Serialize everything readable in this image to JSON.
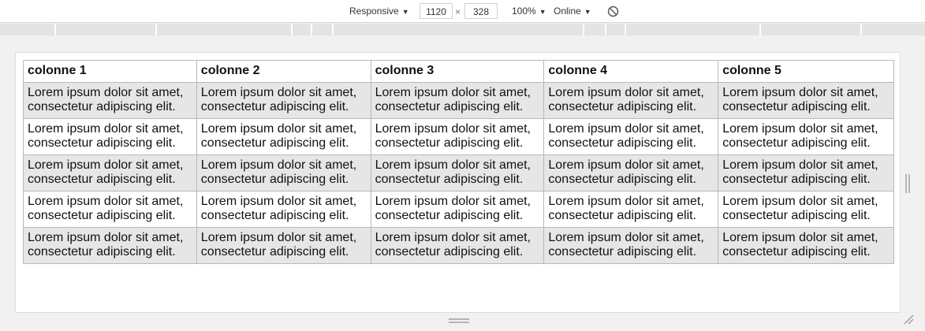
{
  "toolbar": {
    "device_label": "Responsive",
    "width_value": "1120",
    "times_symbol": "×",
    "height_value": "328",
    "zoom_label": "100%",
    "network_label": "Online",
    "caret": "▼"
  },
  "table": {
    "headers": [
      "colonne 1",
      "colonne 2",
      "colonne 3",
      "colonne 4",
      "colonne 5"
    ],
    "rows": [
      [
        "Lorem ipsum dolor sit amet, consectetur adipiscing elit.",
        "Lorem ipsum dolor sit amet, consectetur adipiscing elit.",
        "Lorem ipsum dolor sit amet, consectetur adipiscing elit.",
        "Lorem ipsum dolor sit amet, consectetur adipiscing elit.",
        "Lorem ipsum dolor sit amet, consectetur adipiscing elit."
      ],
      [
        "Lorem ipsum dolor sit amet, consectetur adipiscing elit.",
        "Lorem ipsum dolor sit amet, consectetur adipiscing elit.",
        "Lorem ipsum dolor sit amet, consectetur adipiscing elit.",
        "Lorem ipsum dolor sit amet, consectetur adipiscing elit.",
        "Lorem ipsum dolor sit amet, consectetur adipiscing elit."
      ],
      [
        "Lorem ipsum dolor sit amet, consectetur adipiscing elit.",
        "Lorem ipsum dolor sit amet, consectetur adipiscing elit.",
        "Lorem ipsum dolor sit amet, consectetur adipiscing elit.",
        "Lorem ipsum dolor sit amet, consectetur adipiscing elit.",
        "Lorem ipsum dolor sit amet, consectetur adipiscing elit."
      ],
      [
        "Lorem ipsum dolor sit amet, consectetur adipiscing elit.",
        "Lorem ipsum dolor sit amet, consectetur adipiscing elit.",
        "Lorem ipsum dolor sit amet, consectetur adipiscing elit.",
        "Lorem ipsum dolor sit amet, consectetur adipiscing elit.",
        "Lorem ipsum dolor sit amet, consectetur adipiscing elit."
      ],
      [
        "Lorem ipsum dolor sit amet, consectetur adipiscing elit.",
        "Lorem ipsum dolor sit amet, consectetur adipiscing elit.",
        "Lorem ipsum dolor sit amet, consectetur adipiscing elit.",
        "Lorem ipsum dolor sit amet, consectetur adipiscing elit.",
        "Lorem ipsum dolor sit amet, consectetur adipiscing elit."
      ]
    ]
  },
  "colors": {
    "toolbar_bg": "#ffffff",
    "chrome_bg": "#f1f1f1",
    "media_bar": "#e4e4e4",
    "row_striped": "#e6e6e6",
    "cell_border": "#b9b9b9"
  },
  "icons": {
    "rotate": "rotate-icon",
    "side_resize": "resize-handle-icon",
    "bottom_resize": "resize-handle-icon",
    "corner_resize": "corner-resize-icon"
  }
}
